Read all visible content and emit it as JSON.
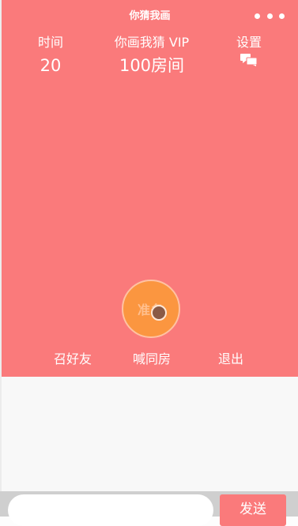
{
  "header": {
    "title": "你猜我画",
    "more_icon": "more-dots-icon"
  },
  "stats": {
    "time_label": "时间",
    "time_value": "20",
    "room_label": "你画我猜 VIP",
    "room_value": "100房间",
    "settings_label": "设置",
    "settings_icon": "chat-bubbles-icon"
  },
  "ready": {
    "label": "准备"
  },
  "actions": {
    "invite_label": "召好友",
    "call_label": "喊同房",
    "exit_label": "退出"
  },
  "input_bar": {
    "placeholder": "",
    "send_label": "发送"
  },
  "colors": {
    "primary": "#fa7a7b",
    "ready_button": "#fb9640",
    "chat_background": "#f8f8f8"
  }
}
